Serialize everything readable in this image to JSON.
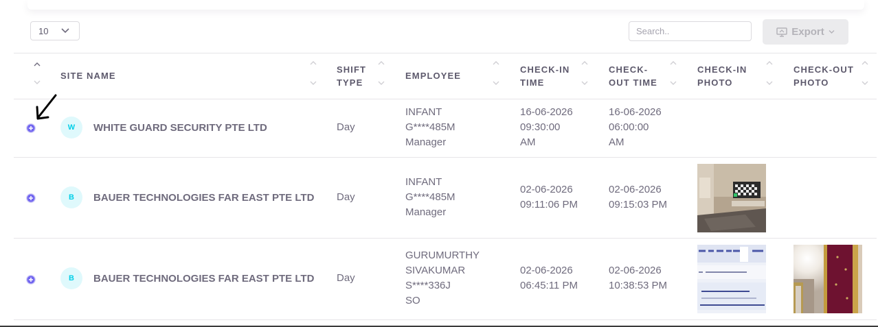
{
  "toolbar": {
    "page_length": "10",
    "search_placeholder": "Search..",
    "export_label": "Export"
  },
  "columns": [
    {
      "line1": "Site Name",
      "line2": ""
    },
    {
      "line1": "Shift",
      "line2": "Type"
    },
    {
      "line1": "Employee",
      "line2": ""
    },
    {
      "line1": "Check-In",
      "line2": "Time"
    },
    {
      "line1": "Check-",
      "line2": "Out Time"
    },
    {
      "line1": "Check-In",
      "line2": "Photo"
    },
    {
      "line1": "Check-Out",
      "line2": "Photo"
    }
  ],
  "rows": [
    {
      "avatar": "W",
      "site": "WHITE GUARD SECURITY PTE LTD",
      "shift": "Day",
      "employee": [
        "INFANT",
        "G****485M",
        "Manager"
      ],
      "checkin": [
        "16-06-2026",
        "09:30:00",
        "AM"
      ],
      "checkout": [
        "16-06-2026",
        "06:00:00",
        "AM"
      ]
    },
    {
      "avatar": "B",
      "site": "BAUER TECHNOLOGIES FAR EAST PTE LTD",
      "shift": "Day",
      "employee": [
        "INFANT",
        "G****485M",
        "Manager"
      ],
      "checkin": [
        "02-06-2026",
        "09:11:06 PM"
      ],
      "checkout": [
        "02-06-2026",
        "09:15:03 PM"
      ]
    },
    {
      "avatar": "B",
      "site": "BAUER TECHNOLOGIES FAR EAST PTE LTD",
      "shift": "Day",
      "employee": [
        "GURUMURTHY",
        "SIVAKUMAR",
        "S****336J",
        "SO"
      ],
      "checkin": [
        "02-06-2026",
        "06:45:11 PM"
      ],
      "checkout": [
        "02-06-2026",
        "10:38:53 PM"
      ]
    }
  ],
  "colors": {
    "accent": "#7367f0",
    "avatar_bg": "#dff9fc",
    "avatar_text": "#00cfe8",
    "text": "#6f6b7d",
    "heading": "#5d596c"
  }
}
